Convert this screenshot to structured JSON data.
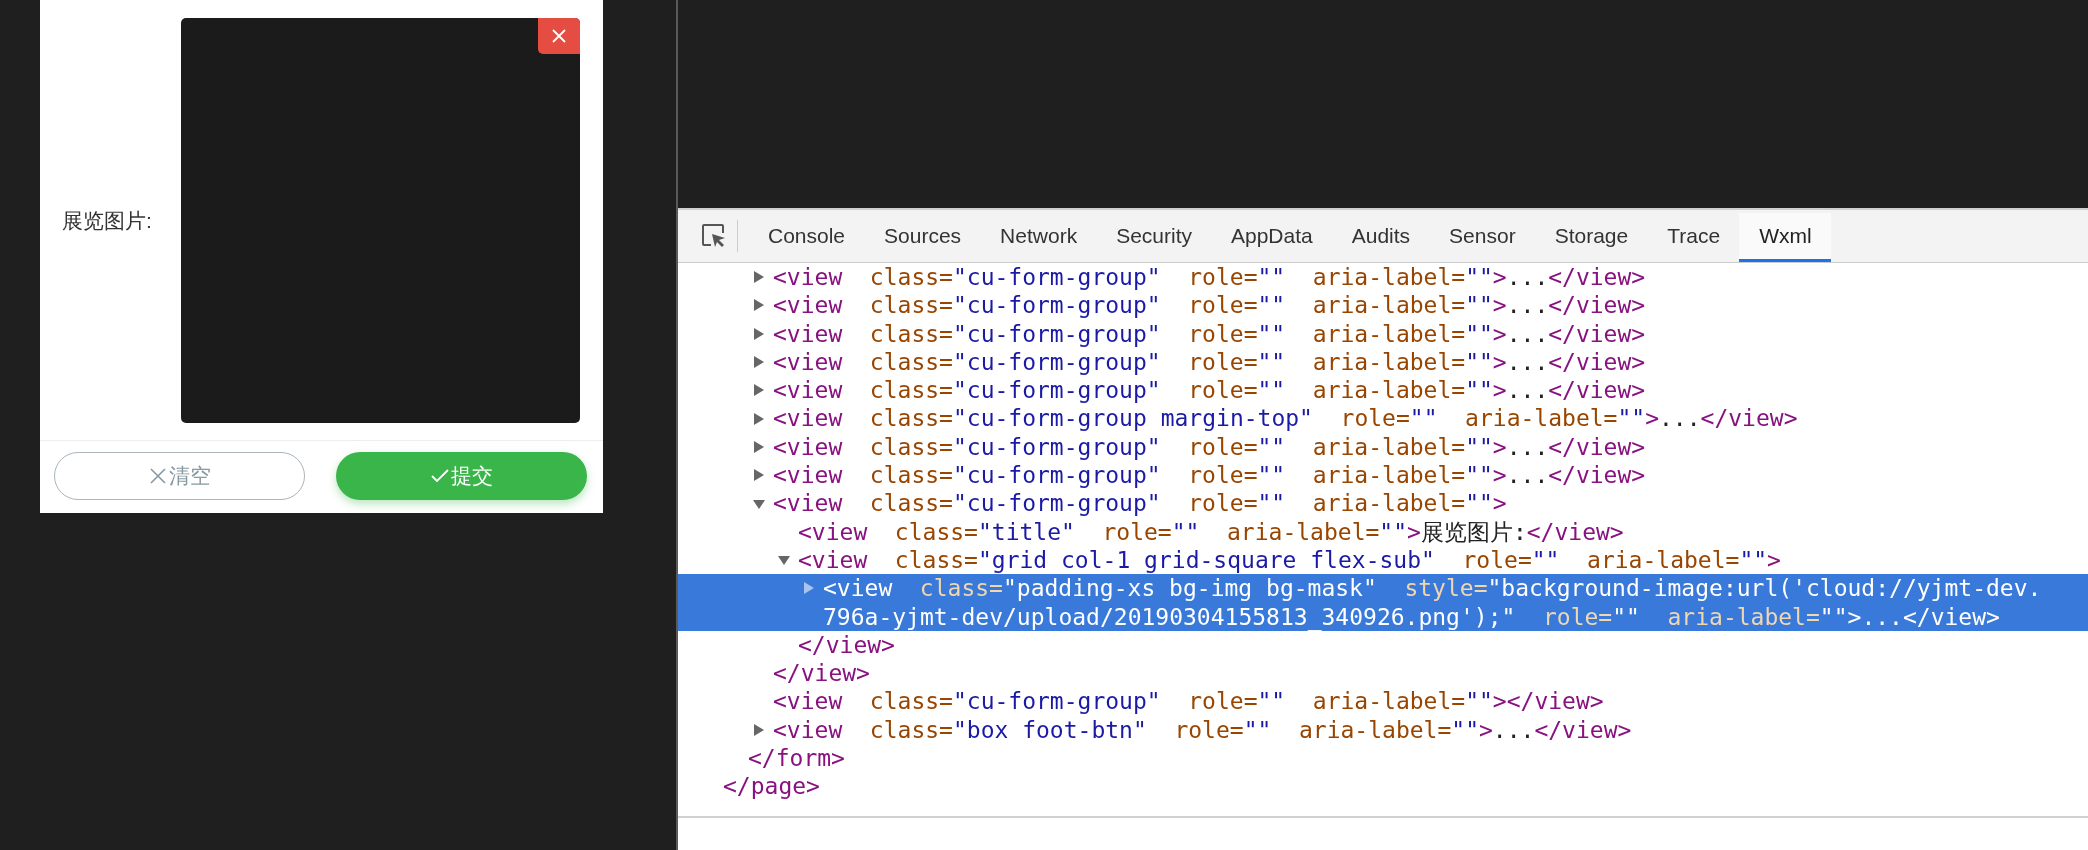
{
  "phone": {
    "field_label": "展览图片:",
    "buttons": [
      {
        "kind": "clear",
        "label": "清空"
      },
      {
        "kind": "submit",
        "label": "提交"
      }
    ]
  },
  "devtools": {
    "tabs": [
      {
        "label": "Console",
        "selected": false
      },
      {
        "label": "Sources",
        "selected": false
      },
      {
        "label": "Network",
        "selected": false
      },
      {
        "label": "Security",
        "selected": false
      },
      {
        "label": "AppData",
        "selected": false
      },
      {
        "label": "Audits",
        "selected": false
      },
      {
        "label": "Sensor",
        "selected": false
      },
      {
        "label": "Storage",
        "selected": false
      },
      {
        "label": "Trace",
        "selected": false
      },
      {
        "label": "Wxml",
        "selected": true
      }
    ],
    "tree": [
      {
        "kind": "expanded",
        "open_scrolled_out": true,
        "close": "</page>",
        "children": [
          {
            "kind": "expanded",
            "open_scrolled_out": true,
            "close": "</form>",
            "children": [
              {
                "kind": "collapsed",
                "selected": false,
                "open": "<view",
                "attrs": [
                  {
                    "name": "class=",
                    "value": "\"cu-form-group\""
                  },
                  {
                    "name": "role=",
                    "value": "\"\""
                  },
                  {
                    "name": "aria-label=",
                    "value": "\"\""
                  }
                ],
                "end": ">",
                "content": "...",
                "close": "</view>"
              },
              {
                "kind": "collapsed",
                "selected": false,
                "open": "<view",
                "attrs": [
                  {
                    "name": "class=",
                    "value": "\"cu-form-group\""
                  },
                  {
                    "name": "role=",
                    "value": "\"\""
                  },
                  {
                    "name": "aria-label=",
                    "value": "\"\""
                  }
                ],
                "end": ">",
                "content": "...",
                "close": "</view>"
              },
              {
                "kind": "collapsed",
                "selected": false,
                "open": "<view",
                "attrs": [
                  {
                    "name": "class=",
                    "value": "\"cu-form-group\""
                  },
                  {
                    "name": "role=",
                    "value": "\"\""
                  },
                  {
                    "name": "aria-label=",
                    "value": "\"\""
                  }
                ],
                "end": ">",
                "content": "...",
                "close": "</view>"
              },
              {
                "kind": "collapsed",
                "selected": false,
                "open": "<view",
                "attrs": [
                  {
                    "name": "class=",
                    "value": "\"cu-form-group\""
                  },
                  {
                    "name": "role=",
                    "value": "\"\""
                  },
                  {
                    "name": "aria-label=",
                    "value": "\"\""
                  }
                ],
                "end": ">",
                "content": "...",
                "close": "</view>"
              },
              {
                "kind": "collapsed",
                "selected": false,
                "open": "<view",
                "attrs": [
                  {
                    "name": "class=",
                    "value": "\"cu-form-group\""
                  },
                  {
                    "name": "role=",
                    "value": "\"\""
                  },
                  {
                    "name": "aria-label=",
                    "value": "\"\""
                  }
                ],
                "end": ">",
                "content": "...",
                "close": "</view>"
              },
              {
                "kind": "collapsed",
                "selected": false,
                "open": "<view",
                "attrs": [
                  {
                    "name": "class=",
                    "value": "\"cu-form-group margin-top\""
                  },
                  {
                    "name": "role=",
                    "value": "\"\""
                  },
                  {
                    "name": "aria-label=",
                    "value": "\"\""
                  }
                ],
                "end": ">",
                "content": "...",
                "close": "</view>"
              },
              {
                "kind": "collapsed",
                "selected": false,
                "open": "<view",
                "attrs": [
                  {
                    "name": "class=",
                    "value": "\"cu-form-group\""
                  },
                  {
                    "name": "role=",
                    "value": "\"\""
                  },
                  {
                    "name": "aria-label=",
                    "value": "\"\""
                  }
                ],
                "end": ">",
                "content": "...",
                "close": "</view>"
              },
              {
                "kind": "collapsed",
                "selected": false,
                "open": "<view",
                "attrs": [
                  {
                    "name": "class=",
                    "value": "\"cu-form-group\""
                  },
                  {
                    "name": "role=",
                    "value": "\"\""
                  },
                  {
                    "name": "aria-label=",
                    "value": "\"\""
                  }
                ],
                "end": ">",
                "content": "...",
                "close": "</view>"
              },
              {
                "kind": "expanded",
                "selected": false,
                "open": "<view",
                "attrs": [
                  {
                    "name": "class=",
                    "value": "\"cu-form-group\""
                  },
                  {
                    "name": "role=",
                    "value": "\"\""
                  },
                  {
                    "name": "aria-label=",
                    "value": "\"\""
                  }
                ],
                "end": ">",
                "close": "</view>",
                "children": [
                  {
                    "kind": "leaf",
                    "selected": false,
                    "open": "<view",
                    "attrs": [
                      {
                        "name": "class=",
                        "value": "\"title\""
                      },
                      {
                        "name": "role=",
                        "value": "\"\""
                      },
                      {
                        "name": "aria-label=",
                        "value": "\"\""
                      }
                    ],
                    "end": ">",
                    "content": "展览图片:",
                    "close": "</view>"
                  },
                  {
                    "kind": "expanded",
                    "selected": false,
                    "open": "<view",
                    "attrs": [
                      {
                        "name": "class=",
                        "value": "\"grid col-1 grid-square flex-sub\""
                      },
                      {
                        "name": "role=",
                        "value": "\"\""
                      },
                      {
                        "name": "aria-label=",
                        "value": "\"\""
                      }
                    ],
                    "end": ">",
                    "close": "</view>",
                    "children": [
                      {
                        "kind": "collapsed",
                        "selected": true,
                        "open": "<view",
                        "attrs": [
                          {
                            "name": "class=",
                            "value": "\"padding-xs bg-img bg-mask\""
                          },
                          {
                            "name": "style=",
                            "value": "\"background-image:url('cloud://yjmt-dev.796a-yjmt-dev/upload/20190304155813_340926.png');\""
                          },
                          {
                            "name": "role=",
                            "value": "\"\""
                          },
                          {
                            "name": "aria-label=",
                            "value": "\"\""
                          }
                        ],
                        "end": ">",
                        "content": "...",
                        "close": "</view>"
                      }
                    ]
                  }
                ]
              },
              {
                "kind": "leaf",
                "selected": false,
                "open": "<view",
                "attrs": [
                  {
                    "name": "class=",
                    "value": "\"cu-form-group\""
                  },
                  {
                    "name": "role=",
                    "value": "\"\""
                  },
                  {
                    "name": "aria-label=",
                    "value": "\"\""
                  }
                ],
                "end": ">",
                "close": "</view>"
              },
              {
                "kind": "collapsed",
                "selected": false,
                "open": "<view",
                "attrs": [
                  {
                    "name": "class=",
                    "value": "\"box foot-btn\""
                  },
                  {
                    "name": "role=",
                    "value": "\"\""
                  },
                  {
                    "name": "aria-label=",
                    "value": "\"\""
                  }
                ],
                "end": ">",
                "content": "...",
                "close": "</view>"
              }
            ]
          }
        ]
      }
    ]
  }
}
